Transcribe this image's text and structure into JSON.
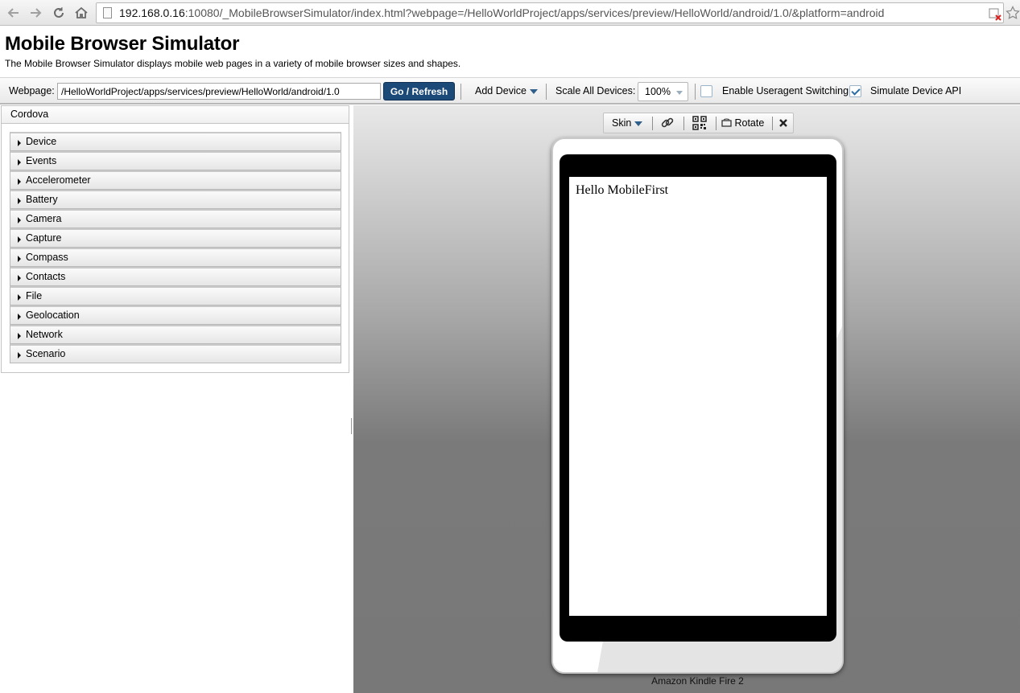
{
  "browser": {
    "url_host": "192.168.0.16",
    "url_rest": ":10080/_MobileBrowserSimulator/index.html?webpage=/HelloWorldProject/apps/services/preview/HelloWorld/android/1.0/&platform=android"
  },
  "header": {
    "title": "Mobile Browser Simulator",
    "subtitle": "The Mobile Browser Simulator displays mobile web pages in a variety of mobile browser sizes and shapes."
  },
  "toolbar": {
    "webpage_label": "Webpage:",
    "webpage_value": "/HelloWorldProject/apps/services/preview/HelloWorld/android/1.0",
    "go_label": "Go / Refresh",
    "add_device_label": "Add Device",
    "scale_label": "Scale All Devices:",
    "scale_value": "100%",
    "useragent_label": "Enable Useragent Switching",
    "useragent_checked": false,
    "simulate_label": "Simulate Device API",
    "simulate_checked": true
  },
  "panel": {
    "title": "Cordova",
    "items": [
      "Device",
      "Events",
      "Accelerometer",
      "Battery",
      "Camera",
      "Capture",
      "Compass",
      "Contacts",
      "File",
      "Geolocation",
      "Network",
      "Scenario"
    ]
  },
  "device": {
    "skin_label": "Skin",
    "rotate_label": "Rotate",
    "screen_text": "Hello MobileFirst",
    "name": "Amazon Kindle Fire 2"
  },
  "colors": {
    "go_button": "#1c4a78",
    "accent_arrow": "#2f5f8a"
  }
}
